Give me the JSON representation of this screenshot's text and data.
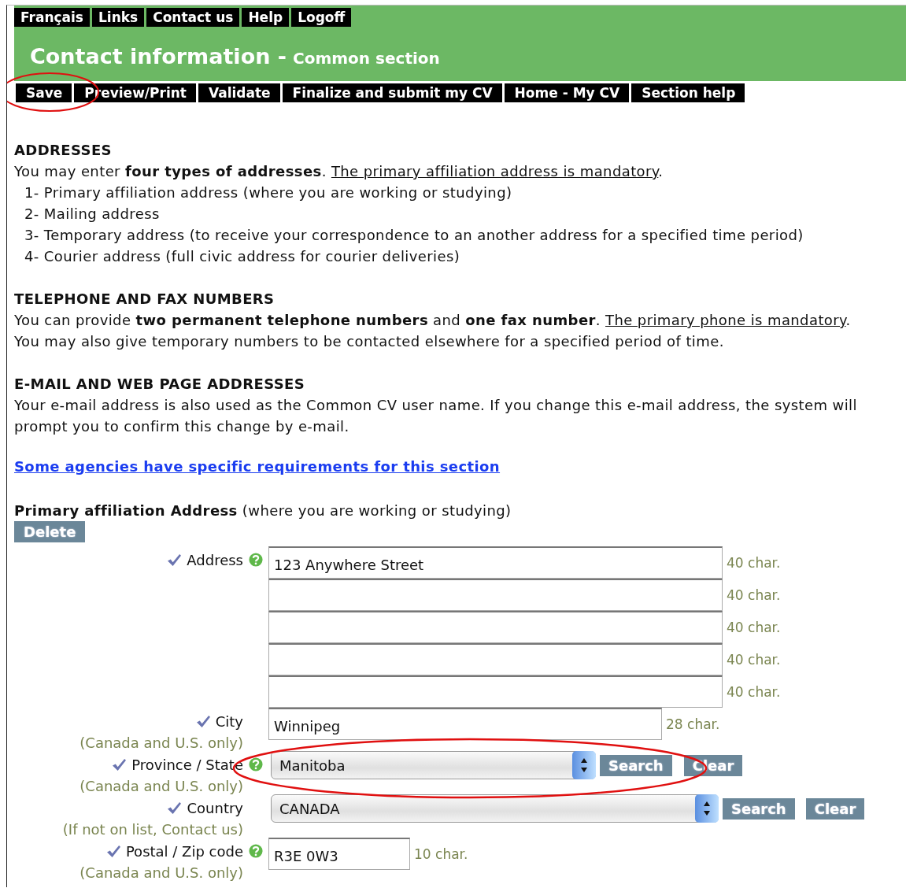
{
  "top_nav": [
    {
      "label": "Français"
    },
    {
      "label": "Links"
    },
    {
      "label": "Contact us"
    },
    {
      "label": "Help"
    },
    {
      "label": "Logoff"
    }
  ],
  "title": "Contact information -",
  "subtitle": "Common section",
  "actions": [
    {
      "label": "Save"
    },
    {
      "label": "Preview/Print"
    },
    {
      "label": "Validate"
    },
    {
      "label": "Finalize and submit my CV"
    },
    {
      "label": "Home - My CV"
    },
    {
      "label": "Section help"
    }
  ],
  "sections": [
    {
      "heading": "ADDRESSES",
      "paragraphs": [
        [
          {
            "text": "You may enter **four types of addresses**. ",
            "underlined": false
          },
          {
            "text": "The primary affiliation address is mandatory",
            "underlined": true
          },
          {
            "text": ".",
            "underlined": false
          }
        ]
      ],
      "list": [
        "1- Primary affiliation address (where you are working or studying)",
        "2- Mailing address",
        "3- Temporary address (to receive your correspondence to an another address for a specified time period)",
        "4- Courier address (full civic address for courier deliveries)"
      ]
    },
    {
      "heading": "TELEPHONE AND FAX NUMBERS",
      "paragraphs": [
        [
          {
            "text": "You can provide **two permanent telephone numbers** and **one fax number**. ",
            "underlined": false
          },
          {
            "text": "The primary phone is mandatory",
            "underlined": true
          },
          {
            "text": ".",
            "underlined": false
          }
        ],
        [
          {
            "text": "You may also give temporary numbers to be contacted elsewhere for a specified period of time.",
            "underlined": false
          }
        ]
      ]
    },
    {
      "heading": "E-MAIL AND WEB PAGE ADDRESSES",
      "paragraphs": [
        [
          {
            "text": "Your e-mail address is also used as the Common CV user name. If you change this e-mail address, the system will prompt you to confirm this change by e-mail.",
            "underlined": false
          }
        ]
      ]
    }
  ],
  "link": "Some agencies have specific requirements for this section",
  "address_heading": "**Primary affiliation Address** (where you are working or studying)",
  "delete_button": "Delete",
  "fields": [
    {
      "kind": "multi",
      "label": "Address",
      "required": true,
      "help": true,
      "lines": [
        {
          "value": "123 Anywhere Street",
          "limit": "40 char."
        },
        {
          "limit": "40 char."
        },
        {
          "limit": "40 char."
        },
        {
          "limit": "40 char."
        },
        {
          "limit": "40 char."
        }
      ]
    },
    {
      "kind": "text",
      "label": "City",
      "note": "(Canada and U.S. only)",
      "required": true,
      "help": false,
      "value": "Winnipeg",
      "limit": "28 char."
    },
    {
      "kind": "select",
      "label": "Province / State",
      "note": "(Canada and U.S. only)",
      "required": true,
      "help": true,
      "value": "Manitoba",
      "buttons": [
        "Search",
        "Clear"
      ]
    },
    {
      "kind": "select",
      "label": "Country",
      "note": "(If not on list, Contact us)",
      "required": true,
      "help": false,
      "value": "CANADA",
      "buttons": [
        "Search",
        "Clear"
      ]
    },
    {
      "kind": "text",
      "label": "Postal / Zip code",
      "note": "(Canada and U.S. only)",
      "required": true,
      "help": true,
      "value": "R3E 0W3",
      "limit": "10 char."
    }
  ]
}
